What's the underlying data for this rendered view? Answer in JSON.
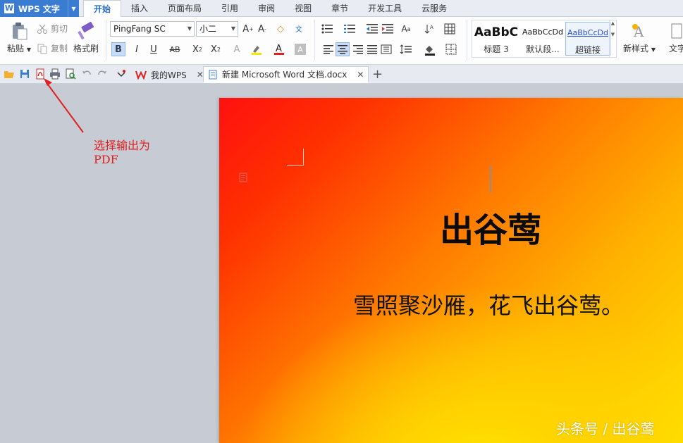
{
  "app": {
    "name": "WPS 文字"
  },
  "menu": [
    "开始",
    "插入",
    "页面布局",
    "引用",
    "审阅",
    "视图",
    "章节",
    "开发工具",
    "云服务"
  ],
  "ribbon": {
    "paste": "粘贴",
    "cut": "剪切",
    "copy": "复制",
    "format_painter": "格式刷",
    "font_name": "PingFang SC",
    "font_size": "小二",
    "styles": [
      {
        "sample": "AaBbC",
        "name": "标题 3"
      },
      {
        "sample": "AaBbCcDd",
        "name": "默认段..."
      },
      {
        "sample": "AaBbCcDd",
        "name": "超链接"
      }
    ],
    "new_style": "新样式",
    "text_tools": "文字"
  },
  "tabs": [
    {
      "label": "我的WPS"
    },
    {
      "label": "新建 Microsoft Word 文档.docx"
    }
  ],
  "document": {
    "title": "出谷莺",
    "body": "雪照聚沙雁，花飞出谷莺。"
  },
  "annotation": {
    "line1": "选择输出为",
    "line2": "PDF"
  },
  "watermark": "头条号 / 出谷莺",
  "colors": {
    "accent": "#3b7cd3",
    "annotation": "#e02020",
    "page_gradient_start": "#ff1010",
    "page_gradient_end": "#ffe000"
  }
}
